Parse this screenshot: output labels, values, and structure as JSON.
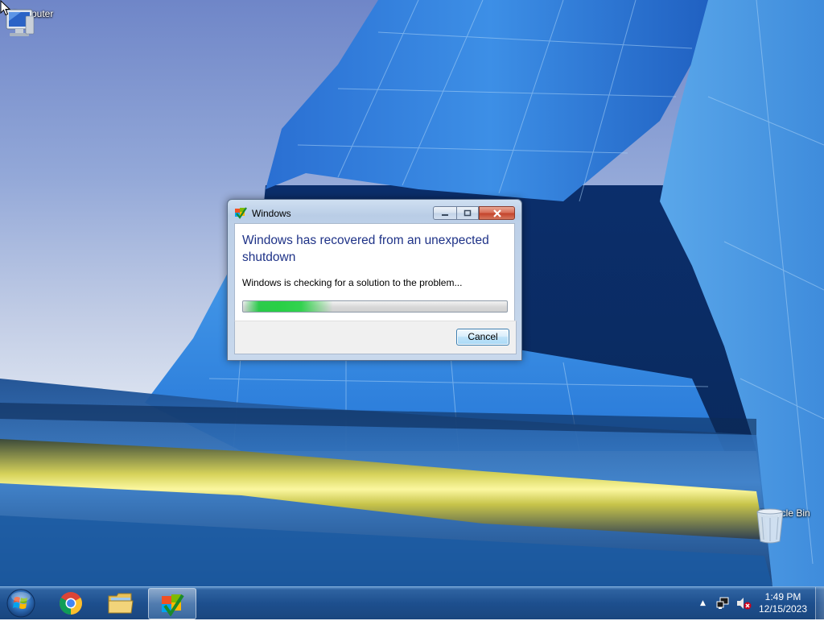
{
  "desktop": {
    "icons": [
      {
        "label": "Computer",
        "icon": "computer-icon"
      },
      {
        "label": "Recycle Bin",
        "icon": "recycle-bin-icon"
      }
    ]
  },
  "dialog": {
    "title": "Windows",
    "main_instruction": "Windows has recovered from an unexpected shutdown",
    "status": "Windows is checking for a solution to the problem...",
    "cancel_label": "Cancel",
    "progress_state": "indeterminate"
  },
  "taskbar": {
    "pinned": [
      {
        "name": "start-button",
        "icon": "windows-logo-icon"
      },
      {
        "name": "chrome",
        "icon": "chrome-icon"
      },
      {
        "name": "windows-explorer",
        "icon": "folder-icon"
      },
      {
        "name": "problem-reporting",
        "icon": "windows-check-icon",
        "active": true
      }
    ],
    "clock": {
      "time": "1:49 PM",
      "date": "12/15/2023"
    }
  },
  "colors": {
    "title_text": "#1e3287",
    "progress_green": "#28d046",
    "taskbar": "#1d4f8e"
  }
}
